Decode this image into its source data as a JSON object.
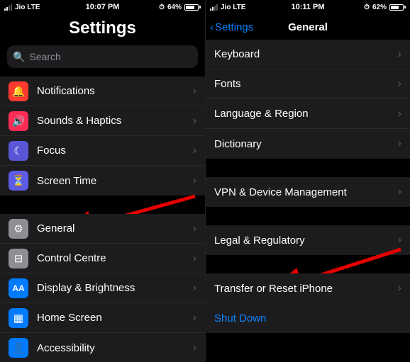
{
  "left": {
    "status": {
      "carrier": "Jio  LTE",
      "time": "10:07 PM",
      "battery": "64%"
    },
    "title": "Settings",
    "search_placeholder": "Search",
    "group1": [
      {
        "name": "notifications",
        "icon": "bell",
        "bg": "bg-red",
        "label": "Notifications"
      },
      {
        "name": "sounds",
        "icon": "speaker",
        "bg": "bg-pink",
        "label": "Sounds & Haptics"
      },
      {
        "name": "focus",
        "icon": "moon",
        "bg": "bg-indigo",
        "label": "Focus"
      },
      {
        "name": "screentime",
        "icon": "hourglass",
        "bg": "bg-purple",
        "label": "Screen Time"
      }
    ],
    "group2": [
      {
        "name": "general",
        "icon": "gear",
        "bg": "bg-gray",
        "label": "General"
      },
      {
        "name": "controlcentre",
        "icon": "switches",
        "bg": "bg-gray",
        "label": "Control Centre"
      },
      {
        "name": "display",
        "icon": "aa",
        "bg": "bg-aa",
        "label": "Display & Brightness"
      },
      {
        "name": "homescreen",
        "icon": "grid",
        "bg": "bg-bluesq",
        "label": "Home Screen"
      },
      {
        "name": "accessibility",
        "icon": "person",
        "bg": "bg-bluesq",
        "label": "Accessibility"
      }
    ]
  },
  "right": {
    "status": {
      "carrier": "Jio  LTE",
      "time": "10:11 PM",
      "battery": "62%"
    },
    "back": "Settings",
    "title": "General",
    "group1": [
      {
        "name": "keyboard",
        "label": "Keyboard"
      },
      {
        "name": "fonts",
        "label": "Fonts"
      },
      {
        "name": "language",
        "label": "Language & Region"
      },
      {
        "name": "dictionary",
        "label": "Dictionary"
      }
    ],
    "group2": [
      {
        "name": "vpn",
        "label": "VPN & Device Management"
      }
    ],
    "group3": [
      {
        "name": "legal",
        "label": "Legal & Regulatory"
      }
    ],
    "group4": [
      {
        "name": "transfer",
        "label": "Transfer or Reset iPhone"
      }
    ],
    "shutdown": "Shut Down"
  }
}
